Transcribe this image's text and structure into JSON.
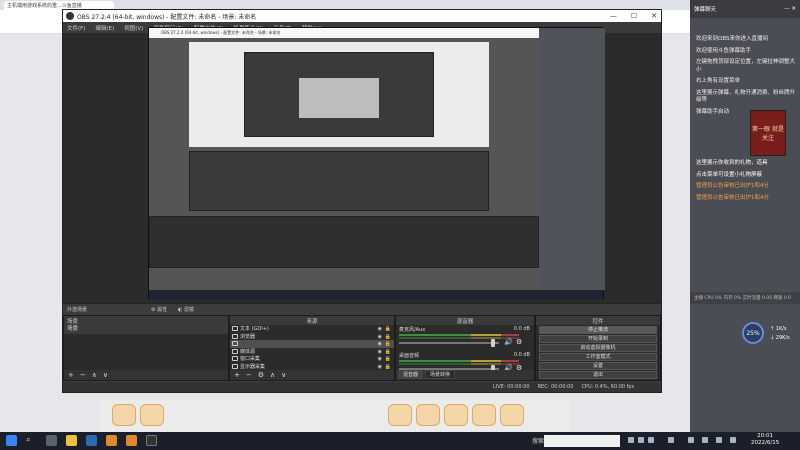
{
  "browser": {
    "tab_title": "主机端用游戏系统的重...斗鱼直播"
  },
  "chat": {
    "header_title": "弹幕聊天",
    "messages": [
      {
        "text": "欢迎来到OBS来你进入直播间",
        "color": "normal"
      },
      {
        "text": "欢迎使用斗鱼弹幕助手",
        "color": "normal"
      },
      {
        "text": "左键拖拽顶部设定位置，左键拉伸调整大小",
        "color": "normal"
      },
      {
        "text": "右上角有设置菜单",
        "color": "normal"
      },
      {
        "text": "这里展示弹幕、礼物开通消费、粉丝牌升级等",
        "color": "normal"
      },
      {
        "text": "弹幕助手启动",
        "color": "normal"
      },
      {
        "text": "这里展示你收到的礼物，道具",
        "color": "white"
      },
      {
        "text": "点击菜单可设置小礼物屏蔽",
        "color": "white"
      },
      {
        "text": "管理员公告审核已出炉1和4分",
        "color": "orange"
      },
      {
        "text": "管理员公告审核已出炉1和4分",
        "color": "orange"
      }
    ],
    "thumb_text": "第一眼 就是关注",
    "status_line": "主播 CPU 0% 内存 0% 实时流量 0.00 网速 0.0",
    "perf_value": "25%",
    "net_up": "↑ 1K/s",
    "net_down": "↓ 29K/s"
  },
  "obs": {
    "window_title": "OBS 27.2.4 (64-bit, windows) - 配置文件: 未命名 - 场景: 未命名",
    "menu": [
      "文件(F)",
      "编辑(E)",
      "视图(V)",
      "停靠窗口(D)",
      "配置文件(P)",
      "场景集合(S)",
      "工具(T)",
      "帮助(H)"
    ],
    "scene_bar_label": "外选场景",
    "scene_bar_props": "属性",
    "scene_bar_filters": "滤镜",
    "docks": {
      "scenes": {
        "title": "场景",
        "items": [
          "场景"
        ]
      },
      "sources": {
        "title": "来源",
        "items": [
          {
            "label": "文本 (GDI+)",
            "selected": false
          },
          {
            "label": "浏览器",
            "selected": false
          },
          {
            "label": "",
            "selected": true
          },
          {
            "label": "媒体源",
            "selected": false
          },
          {
            "label": "窗口采集",
            "selected": false
          },
          {
            "label": "显示器采集",
            "selected": false
          }
        ]
      },
      "mixer": {
        "title": "混音器",
        "channels": [
          {
            "name": "麦克风/Aux",
            "db": "0.0 dB"
          },
          {
            "name": "桌面音频",
            "db": "0.0 dB"
          }
        ],
        "tabs": [
          "混音器",
          "场景转换"
        ]
      },
      "controls": {
        "title": "控件",
        "buttons": [
          "停止推流",
          "开始录制",
          "启动虚拟摄像机",
          "工作室模式",
          "设置",
          "退出"
        ]
      }
    },
    "status": {
      "live": "LIVE: 00:00:00",
      "rec": "REC: 00:00:00",
      "cpu": "CPU: 0.4%, 60.00 fps"
    },
    "preview_title": "OBS 27.2.4 (64-bit, windows) - 配置文件: 未命名 - 场景: 未命名"
  },
  "taskbar": {
    "search_label": "搜索",
    "time": "20:01",
    "date": "2022/6/15"
  }
}
